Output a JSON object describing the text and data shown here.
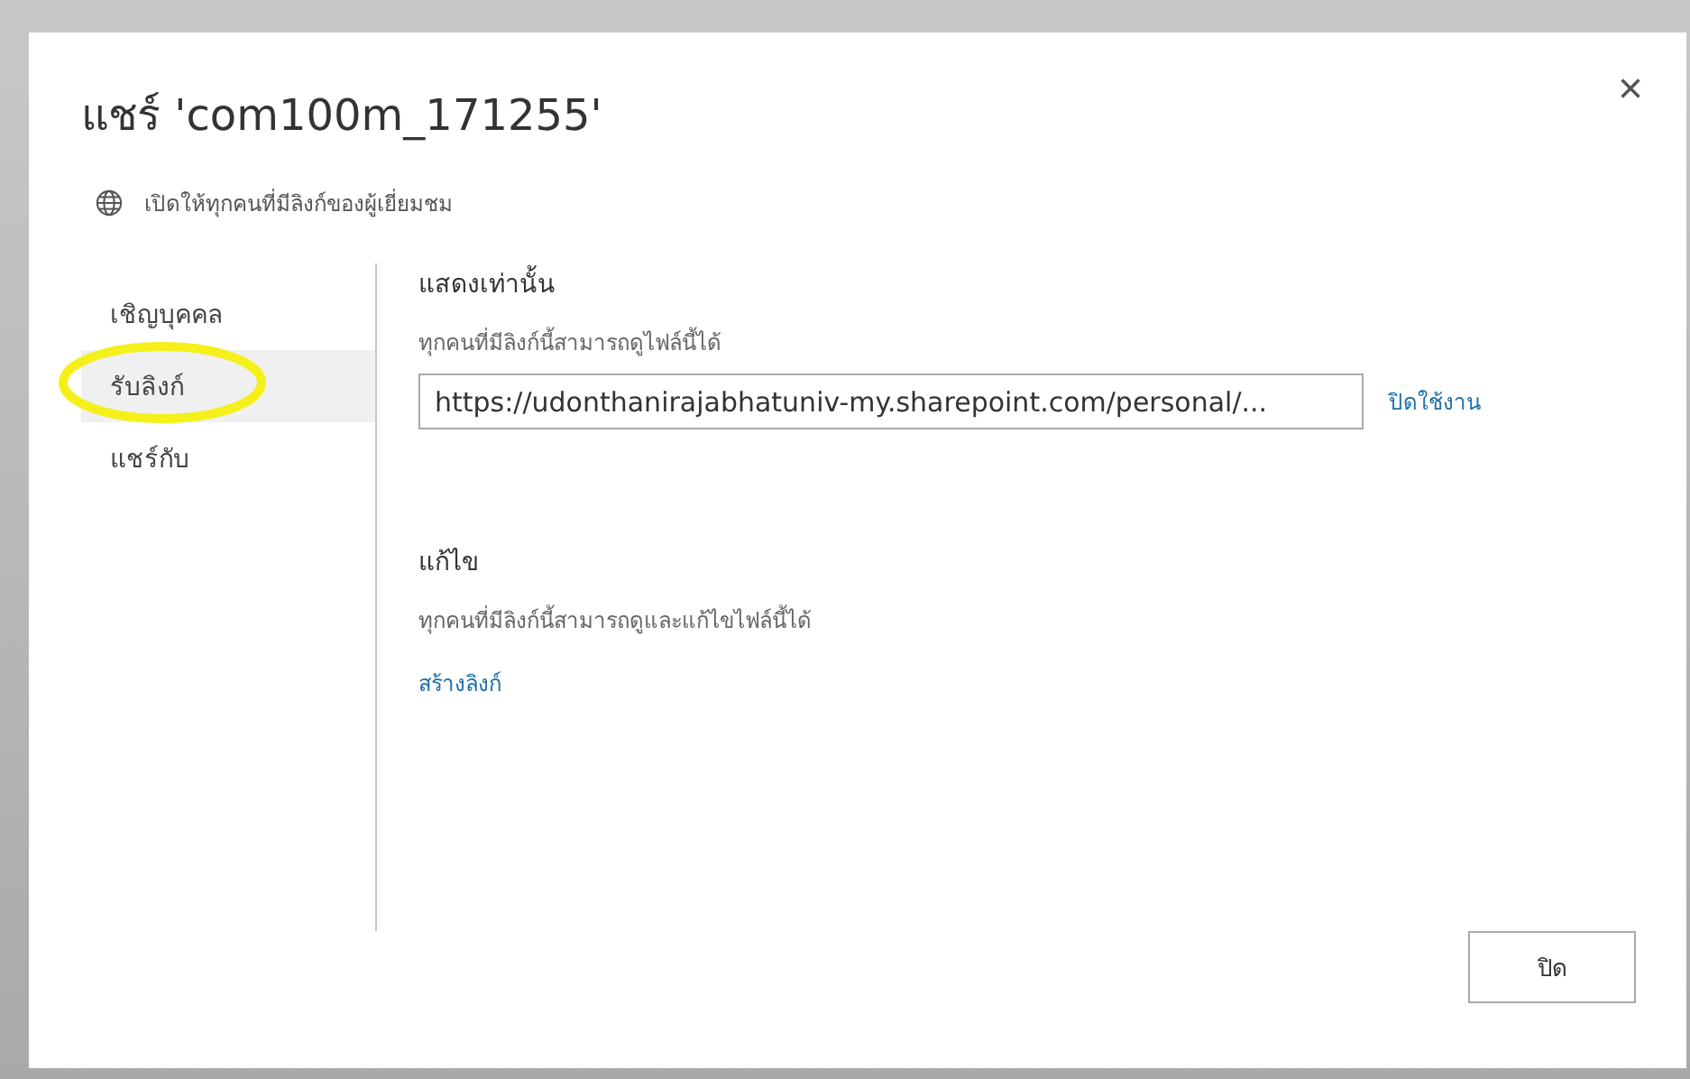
{
  "dialog": {
    "title": "แชร์ 'com100m_171255'",
    "subtitle": "เปิดให้ทุกคนที่มีลิงก์ของผู้เยี่ยมชม",
    "close_label": "×"
  },
  "nav": [
    {
      "label": "เชิญบุคคล",
      "selected": false,
      "circled": false
    },
    {
      "label": "รับลิงก์",
      "selected": true,
      "circled": true
    },
    {
      "label": "แชร์กับ",
      "selected": false,
      "circled": false
    }
  ],
  "sections": [
    {
      "heading": "แสดงเท่านั้น",
      "description": "ทุกคนที่มีลิงก์นี้สามารถดูไฟล์นี้ได้",
      "kind": "link",
      "url": "https://udonthanirajabhatuniv-my.sharepoint.com/personal/...",
      "action": "ปิดใช้งาน"
    },
    {
      "heading": "แก้ไข",
      "description": "ทุกคนที่มีลิงก์นี้สามารถดูและแก้ไขไฟล์นี้ได้",
      "kind": "create",
      "action": "สร้างลิงก์"
    }
  ],
  "footer": {
    "button": "ปิด"
  }
}
